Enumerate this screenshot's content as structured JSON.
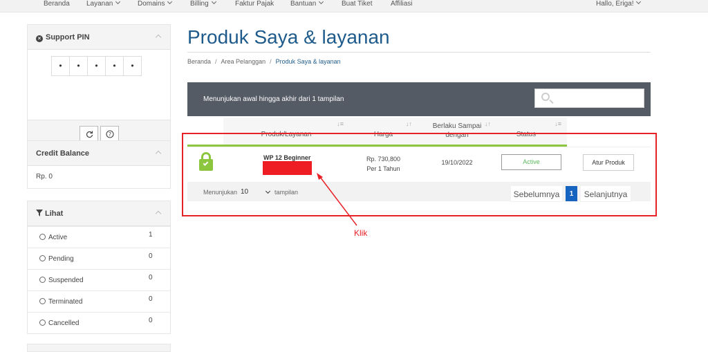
{
  "nav": {
    "items": [
      {
        "label": "Beranda",
        "caret": false
      },
      {
        "label": "Layanan",
        "caret": true
      },
      {
        "label": "Domains",
        "caret": true
      },
      {
        "label": "Billing",
        "caret": true
      },
      {
        "label": "Faktur Pajak",
        "caret": false
      },
      {
        "label": "Bantuan",
        "caret": true
      },
      {
        "label": "Buat Tiket",
        "caret": false
      },
      {
        "label": "Affiliasi",
        "caret": false
      }
    ],
    "greeting": "Hallo, Eriga!"
  },
  "sidebar": {
    "support_pin": {
      "title": "Support PIN",
      "digits": [
        "•",
        "•",
        "•",
        "•",
        "•"
      ],
      "refresh_icon": "refresh-icon",
      "help_icon": "help-icon"
    },
    "credit": {
      "title": "Credit Balance",
      "value": "Rp. 0"
    },
    "filter": {
      "title": "Lihat",
      "items": [
        {
          "label": "Active",
          "count": "1"
        },
        {
          "label": "Pending",
          "count": "0"
        },
        {
          "label": "Suspended",
          "count": "0"
        },
        {
          "label": "Terminated",
          "count": "0"
        },
        {
          "label": "Cancelled",
          "count": "0"
        }
      ]
    }
  },
  "main": {
    "title": "Produk Saya & layanan",
    "breadcrumb": [
      "Beranda",
      "Area Pelanggan",
      "Produk Saya & layanan"
    ],
    "table_info": "Menunjukan awal hingga akhir dari 1 tampilan",
    "columns": {
      "product": "Produk/Layanan",
      "price": "Harga",
      "due_line1": "Berlaku Sampai",
      "due_line2": "dengan",
      "status": "Status"
    },
    "rows": [
      {
        "product": "WP 12 Beginner",
        "price_line1": "Rp. 730,800",
        "price_line2": "Per 1 Tahun",
        "due": "19/10/2022",
        "status": "Active",
        "action": "Atur Produk"
      }
    ],
    "footer": {
      "show_prefix": "Menunjukan",
      "page_size": "10",
      "show_suffix": "tampilan",
      "prev": "Sebelumnya",
      "current_page": "1",
      "next": "Selanjutnya"
    }
  },
  "annotation": {
    "label": "Klik",
    "color": "#e82127"
  },
  "colors": {
    "accent": "#1e5b8c",
    "status_green": "#8cc63f",
    "table_header": "#555b65",
    "page_active": "#1565c0"
  }
}
